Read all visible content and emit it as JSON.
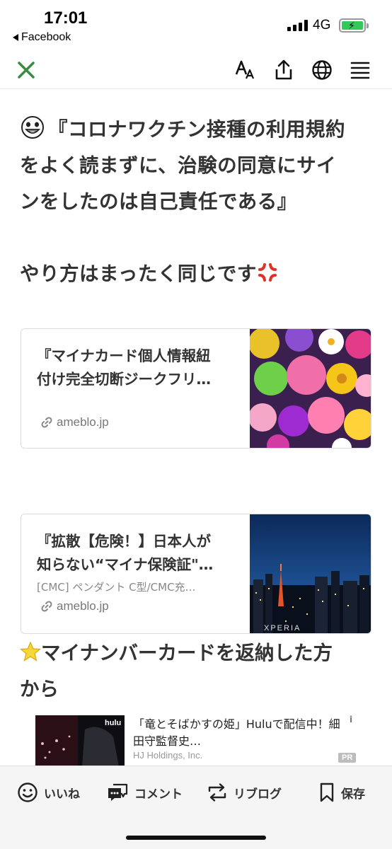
{
  "status_bar": {
    "time": "17:01",
    "back_label": "Facebook",
    "network": "4G"
  },
  "toolbar": {
    "close_icon": "close-icon",
    "font_size_icon": "font-size-icon",
    "share_icon": "share-icon",
    "globe_icon": "globe-icon",
    "menu_icon": "menu-icon",
    "accent_color": "#3a8a3f"
  },
  "article": {
    "headline_lines": [
      "『コロナワクチン接種の利用規約",
      "をよく読まずに、治験の同意にサイ",
      "ンをしたのは自己責任である』"
    ],
    "sub_line": "やり方はまったく同じです",
    "section2_lines": [
      "マイナンバーカードを返納した方",
      "から"
    ]
  },
  "cards": [
    {
      "title_lines": [
        "『マイナカード個人情報紐",
        "付け完全切断ジークフリ…"
      ],
      "subtitle": "",
      "domain": "ameblo.jp"
    },
    {
      "title_lines": [
        "『拡散【危険！】日本人が",
        "知らない“マイナ保険証\"…"
      ],
      "subtitle": "[CMC] ペンダント C型/CMC充…",
      "domain": "ameblo.jp",
      "image_watermark": "XPERIA"
    }
  ],
  "ad": {
    "title_lines": [
      "「竜とそばかすの姫」Huluで配信中！細",
      "田守監督史…"
    ],
    "source": "HJ Holdings, Inc.",
    "badge": "PR",
    "thumb_logo": "hulu",
    "info_icon": "i"
  },
  "bottom_bar": {
    "like": "いいね",
    "comment": "コメント",
    "reblog": "リブログ",
    "save": "保存"
  }
}
